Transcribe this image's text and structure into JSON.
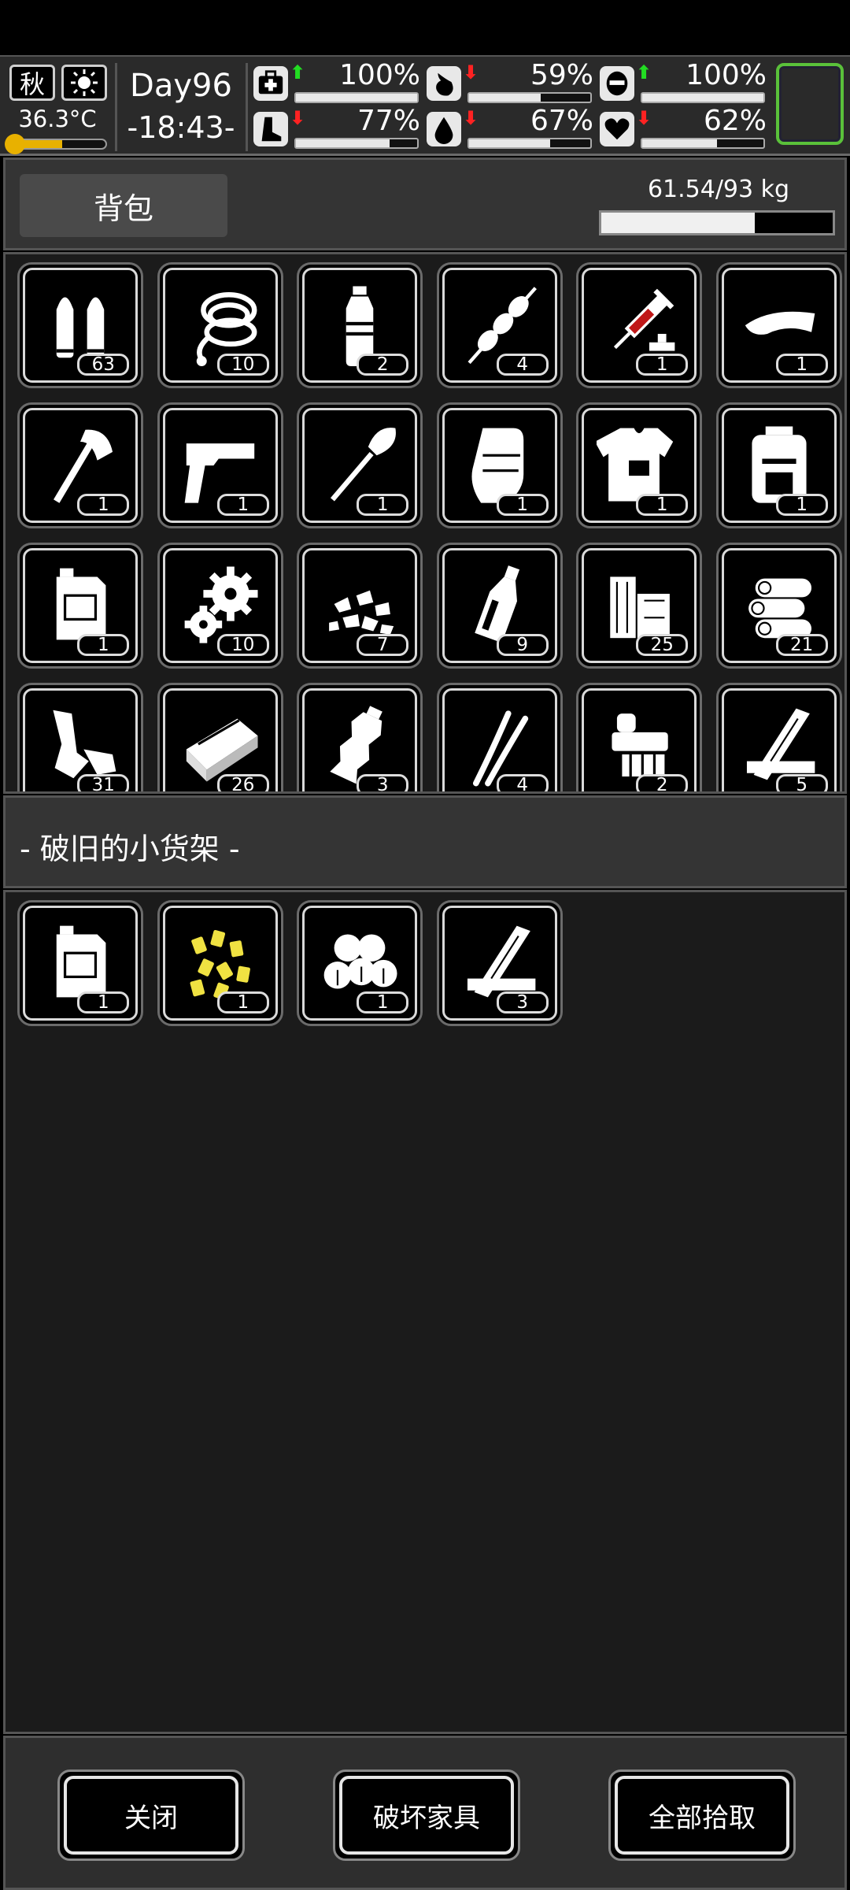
{
  "status_bar": {
    "season": "秋",
    "temperature": "36.3°C",
    "temperature_level": 0.55,
    "day": "Day96",
    "time": "-18:43-",
    "stats": [
      {
        "name": "health",
        "icon": "medkit-icon",
        "trend": "up",
        "value": "100%",
        "level": 1.0
      },
      {
        "name": "hunger",
        "icon": "stomach-icon",
        "trend": "down",
        "value": "59%",
        "level": 0.59
      },
      {
        "name": "mood",
        "icon": "mask-icon",
        "trend": "up",
        "value": "100%",
        "level": 1.0
      },
      {
        "name": "stamina",
        "icon": "foot-icon",
        "trend": "down",
        "value": "77%",
        "level": 0.77
      },
      {
        "name": "thirst",
        "icon": "water-drop-icon",
        "trend": "down",
        "value": "67%",
        "level": 0.67
      },
      {
        "name": "heart",
        "icon": "heart-icon",
        "trend": "down",
        "value": "62%",
        "level": 0.62
      }
    ],
    "arrow_up": "⬆",
    "arrow_down": "⬇",
    "accent_green": "#5ac13a"
  },
  "backpack": {
    "tab_label": "背包",
    "weight": "61.54/93 kg",
    "weight_level": 0.6617,
    "items": [
      {
        "icon": "bullets-icon",
        "qty": "63"
      },
      {
        "icon": "rope-icon",
        "qty": "10"
      },
      {
        "icon": "water-bottle-icon",
        "qty": "2"
      },
      {
        "icon": "skewer-icon",
        "qty": "4"
      },
      {
        "icon": "syringe-icon",
        "qty": "1"
      },
      {
        "icon": "visor-cap-icon",
        "qty": "1"
      },
      {
        "icon": "axe-icon",
        "qty": "1"
      },
      {
        "icon": "pistol-icon",
        "qty": "1"
      },
      {
        "icon": "shovel-icon",
        "qty": "1"
      },
      {
        "icon": "gauntlet-icon",
        "qty": "1"
      },
      {
        "icon": "body-armor-icon",
        "qty": "1"
      },
      {
        "icon": "backpack-icon",
        "qty": "1"
      },
      {
        "icon": "jerrycan-icon",
        "qty": "1"
      },
      {
        "icon": "gears-icon",
        "qty": "10"
      },
      {
        "icon": "rubble-icon",
        "qty": "7"
      },
      {
        "icon": "glass-bottle-icon",
        "qty": "9"
      },
      {
        "icon": "wood-blocks-icon",
        "qty": "25"
      },
      {
        "icon": "logs-icon",
        "qty": "21"
      },
      {
        "icon": "scrap-metal-icon",
        "qty": "31"
      },
      {
        "icon": "brick-icon",
        "qty": "26"
      },
      {
        "icon": "plastic-bottle-icon",
        "qty": "3"
      },
      {
        "icon": "wires-icon",
        "qty": "4"
      },
      {
        "icon": "electronic-parts-icon",
        "qty": "2"
      },
      {
        "icon": "planks-icon",
        "qty": "5"
      }
    ]
  },
  "container": {
    "title": "- 破旧的小货架 -",
    "items": [
      {
        "icon": "jerrycan-icon",
        "qty": "1"
      },
      {
        "icon": "yellow-pellets-icon",
        "qty": "1"
      },
      {
        "icon": "cotton-balls-icon",
        "qty": "1"
      },
      {
        "icon": "planks-icon",
        "qty": "3"
      }
    ]
  },
  "footer": {
    "close_label": "关闭",
    "destroy_label": "破坏家具",
    "take_all_label": "全部拾取"
  }
}
